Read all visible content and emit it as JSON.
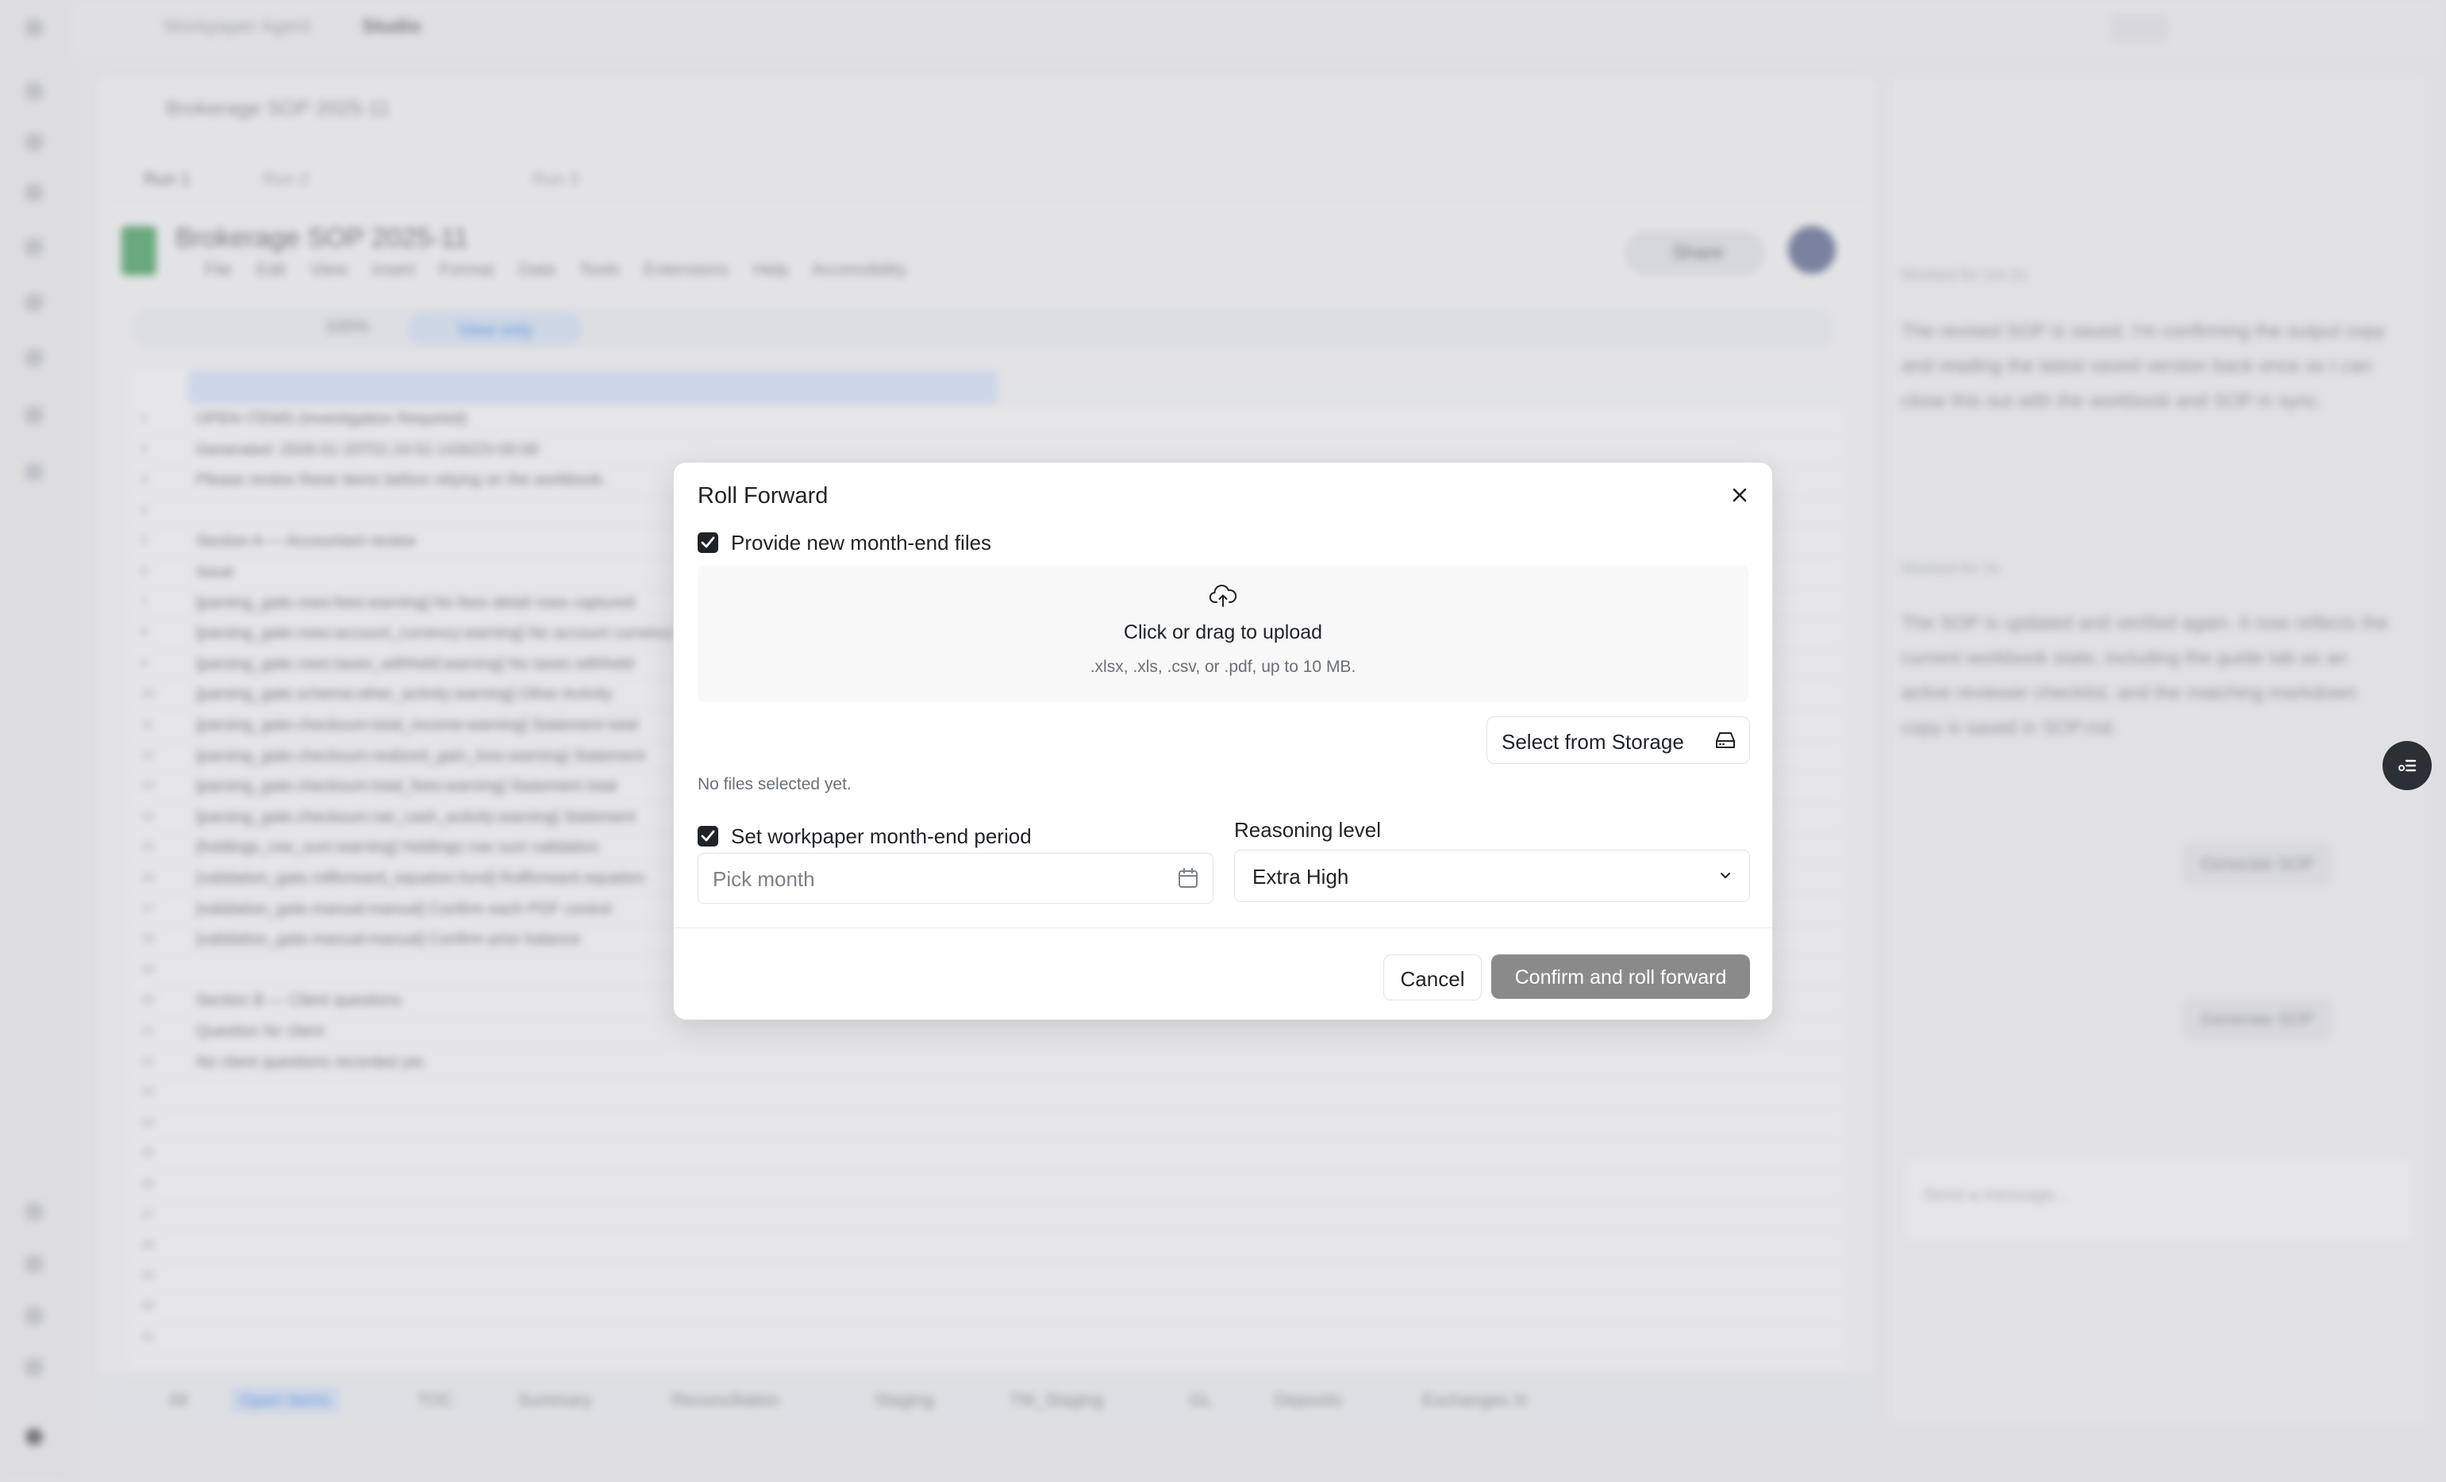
{
  "background": {
    "breadcrumb": [
      "Workpaper Agent",
      "Studio"
    ],
    "doc_title": "Brokerage SOP 2025-11",
    "sheet_tabs_top": [
      "Run 1",
      "Run 2",
      "Run 3"
    ],
    "sheet_title": "Brokerage SOP 2025-11",
    "menu": [
      "File",
      "Edit",
      "View",
      "Insert",
      "Format",
      "Data",
      "Tools",
      "Extensions",
      "Help",
      "Accessibility"
    ],
    "share_label": "Share",
    "zoom": "100%",
    "view_only": "View only",
    "rows": [
      "OPEN ITEMS (Investigation Required)",
      "Generated: 2026-01-20T01:24:52.143023+00:00",
      "Please review these items before relying on the workbook.",
      "",
      "Section A — Accountant review",
      "Issue",
      "[parsing_gate.rows:fees:warning] No fees detail rows captured",
      "[parsing_gate.rows:account_currency:warning] No account currency",
      "[parsing_gate.rows:taxes_withheld:warning] No taxes withheld",
      "[parsing_gate.schema:other_activity:warning] Other Activity",
      "[parsing_gate.checksum:total_income:warning] Statement total",
      "[parsing_gate.checksum:realized_gain_loss:warning] Statement",
      "[parsing_gate.checksum:total_fees:warning] Statement total",
      "[parsing_gate.checksum:net_cash_activity:warning] Statement",
      "[holdings_row_sum:warning] Holdings row sum validation",
      "[validation_gate.rollforward_equation:fund] Rollforward equation",
      "[validation_gate.manual:manual] Confirm each PDF control",
      "[validation_gate.manual:manual] Confirm prior balance",
      "",
      "Section B — Client questions",
      "Question for client",
      "No client questions recorded yet."
    ],
    "bottom_tabs": [
      "All",
      "Open Items",
      "TOC",
      "Summary",
      "Reconciliation",
      "Staging",
      "TM_Staging",
      "GL",
      "Deposits",
      "Exchanges In"
    ],
    "right_panel": {
      "worked_1": "Worked for 1m 2s",
      "text_1": "The revised SOP is saved. I'm confirming the output copy and reading the latest saved version back once so I can close this out with the workbook and SOP in sync.",
      "worked_2": "Worked for 2s",
      "text_2": "The SOP is updated and verified again. It now reflects the current workbook state, including the guide tab as an active reviewer checklist, and the matching markdown copy is saved in SOP.md.",
      "chip": "Generate SOP",
      "message_placeholder": "Send a message..."
    }
  },
  "modal": {
    "title": "Roll Forward",
    "provide_files": {
      "label": "Provide new month-end files",
      "checked": true
    },
    "upload": {
      "title": "Click or drag to upload",
      "hint": ".xlsx, .xls, .csv, or .pdf, up to 10 MB."
    },
    "select_storage_label": "Select from Storage",
    "no_files_text": "No files selected yet.",
    "set_period": {
      "label": "Set workpaper month-end period",
      "checked": true
    },
    "pick_month_placeholder": "Pick month",
    "reasoning": {
      "label": "Reasoning level",
      "value": "Extra High"
    },
    "cancel_label": "Cancel",
    "confirm_label": "Confirm and roll forward"
  },
  "colors": {
    "accent": "#1f2328",
    "confirm_disabled": "#8a8a8a",
    "sheets_green": "#1e8e3e"
  },
  "icons": [
    "close-icon",
    "check-icon",
    "cloud-upload-icon",
    "storage-drive-icon",
    "calendar-icon",
    "chevron-down-icon"
  ]
}
